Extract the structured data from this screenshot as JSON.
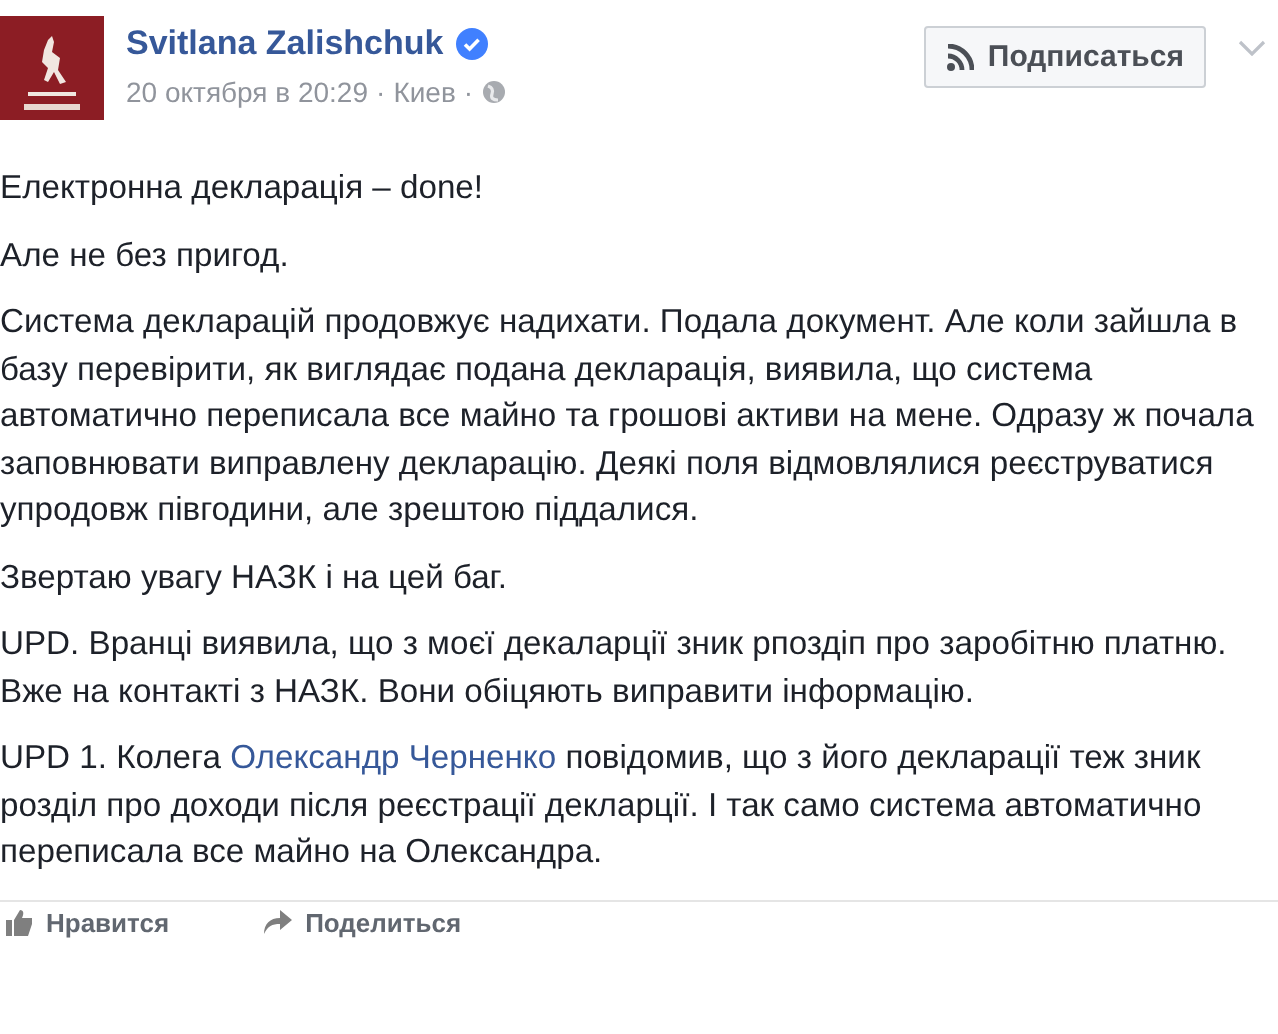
{
  "post": {
    "author": "Svitlana Zalishchuk",
    "verified": true,
    "date": "20 октября в 20:29",
    "separator": "·",
    "location": "Киев",
    "audience_separator": "·"
  },
  "follow_button": {
    "label": "Подписаться"
  },
  "paragraphs": [
    {
      "text": "Електронна декларація – done!"
    },
    {
      "text": "Але не без пригод."
    },
    {
      "text": "Система декларацій продовжує надихати. Подала документ. Але коли зайшла в базу перевірити, як виглядає подана декларація, виявила, що система автоматично переписала все майно та грошові активи на мене. Одразу ж почала заповнювати виправлену декларацію. Деякі поля відмовлялися реєструватися упродовж півгодини, але зрештою піддалися."
    },
    {
      "text": "Звертаю увагу НАЗК і на цей баг."
    },
    {
      "text": "UPD. Вранці виявила, що з моєї декаларції зник рпоздіп про заробітню платню. Вже на контакті з НАЗК. Вони обіцяють виправити інформацію."
    },
    {
      "text": "UPD 1. Колега ",
      "link": "Олександр Черненко",
      "after": " повідомив, що з його декларації теж зник розділ про доходи після реєстрації декларції. І так само система автоматично переписала все майно на Олександра."
    }
  ],
  "actions": [
    {
      "label": "Нравится",
      "kind": "like"
    },
    {
      "label": "Поделиться",
      "kind": "share"
    }
  ]
}
